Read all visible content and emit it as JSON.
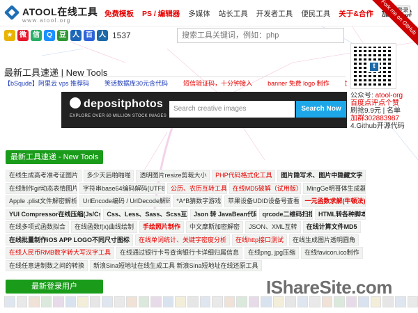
{
  "header": {
    "logo_text": "ATOOL在线工具",
    "logo_sub": "www.atool.org",
    "nav": [
      {
        "label": "免费模板",
        "style": "red bold"
      },
      {
        "label": "PS / 编辑器",
        "style": "red bold"
      },
      {
        "label": "多媒体",
        "style": ""
      },
      {
        "label": "站长工具",
        "style": ""
      },
      {
        "label": "开发者工具",
        "style": ""
      },
      {
        "label": "便民工具",
        "style": ""
      },
      {
        "label": "关于&合作",
        "style": "red bold"
      },
      {
        "label": "加 QQ 群",
        "style": "bold"
      }
    ],
    "qq_login": "QQ登录",
    "ribbon": "Fork me on GitHub"
  },
  "social": {
    "icons": [
      {
        "name": "star-icon",
        "color": "#e8b400",
        "glyph": "★"
      },
      {
        "name": "weibo-icon",
        "color": "#e6162d",
        "glyph": "微"
      },
      {
        "name": "wechat-icon",
        "color": "#2aae67",
        "glyph": "信"
      },
      {
        "name": "qq-icon",
        "color": "#1e90ff",
        "glyph": "Q"
      },
      {
        "name": "douban-icon",
        "color": "#2f9833",
        "glyph": "豆"
      },
      {
        "name": "renren-icon",
        "color": "#1d66b7",
        "glyph": "人"
      },
      {
        "name": "baidu-icon",
        "color": "#2f64d8",
        "glyph": "百"
      },
      {
        "name": "share-icon",
        "color": "#1e6aa8",
        "glyph": "人"
      }
    ],
    "count": "1537"
  },
  "search": {
    "placeholder": "搜索工具关键词，例如：php"
  },
  "qr": {
    "center_glyph": "t"
  },
  "sidebar": {
    "line1_prefix": "公众号: ",
    "line1_highlight": "atool-org",
    "line2": "百度点评点个赞",
    "line3": "刷抢9.9元 | 名单",
    "line4": "加群302883987",
    "line5": "4.Github开源代码"
  },
  "main": {
    "section_title": "最新工具速递 | New Tools",
    "tickers": [
      {
        "text": "【bSqude】阿里云 vps 推荐码",
        "style": ""
      },
      {
        "text": "笑话数据库30元含代码",
        "style": ""
      },
      {
        "text": "短信验证码，十分钟接入",
        "style": "m"
      },
      {
        "text": "banner 免费 logo 制作",
        "style": "m"
      },
      {
        "text": "加群",
        "style": "m"
      }
    ],
    "ad": {
      "brand": "depositphotos",
      "sub": "EXPLORE OVER 60 MILLION STOCK IMAGES",
      "input_placeholder": "Search creative images",
      "button": "Search Now"
    },
    "new_tools_button": "最新工具速递 - New Tools",
    "tools": [
      [
        {
          "t": "在线生成高考准考证图片",
          "s": ""
        },
        {
          "t": "多少天后啪啪啪",
          "s": ""
        },
        {
          "t": "透明图片resize剪裁大小",
          "s": ""
        },
        {
          "t": "PHP代码格式化工具",
          "s": "red"
        },
        {
          "t": "图片隐写术、图片中隐藏文字",
          "s": "b"
        }
      ],
      [
        {
          "t": "在线制作gif动态表情图片",
          "s": ""
        },
        {
          "t": "字符串base64编码解码(UTF8)",
          "s": ""
        },
        {
          "t": "公历、农历互转工具",
          "s": "red"
        },
        {
          "t": "在线MD5破解（试用版）",
          "s": "red"
        },
        {
          "t": "MingGe明哥体生成器",
          "s": ""
        }
      ],
      [
        {
          "t": "Apple .plist文件解密解析",
          "s": ""
        },
        {
          "t": "UrlEncode编码 / UrlDecode解码",
          "s": ""
        },
        {
          "t": "*A*B猜数字游戏",
          "s": ""
        },
        {
          "t": "苹果设备UDID设备号查看",
          "s": ""
        },
        {
          "t": "一元函数求解(牛顿法)",
          "s": "bred"
        }
      ],
      [
        {
          "t": "YUI Compressor在线压缩(Js/Css)",
          "s": "b"
        },
        {
          "t": "Css、Less、Sass、Scss互转",
          "s": "b"
        },
        {
          "t": "Json 转 JavaBean代码",
          "s": "b"
        },
        {
          "t": "qrcode二维码扫描",
          "s": "b"
        },
        {
          "t": "HTML转各种脚本",
          "s": "b"
        }
      ],
      [
        {
          "t": "在线多项式函数拟合",
          "s": ""
        },
        {
          "t": "在线函数f(x)曲线绘制",
          "s": ""
        },
        {
          "t": "手绘照片制作",
          "s": "bred"
        },
        {
          "t": "中文摩斯加密解密",
          "s": ""
        },
        {
          "t": "JSON、XML互转",
          "s": ""
        },
        {
          "t": "在线计算文件MD5",
          "s": "b"
        }
      ],
      [
        {
          "t": "在线批量制作iOS APP LOGO不同尺寸图标",
          "s": "b"
        },
        {
          "t": "在线单词统计、关键字密度分析",
          "s": "red"
        },
        {
          "t": "在线http接口测试",
          "s": "red"
        },
        {
          "t": "在线生成图片透明圆角",
          "s": ""
        }
      ],
      [
        {
          "t": "在线人民币RMB数字转大写汉字工具",
          "s": "red"
        },
        {
          "t": "在线通过银行卡号查询银行卡详细归属信息",
          "s": ""
        },
        {
          "t": "在线png, jpg压缩",
          "s": ""
        },
        {
          "t": "在线favicon.ico制作",
          "s": ""
        }
      ],
      [
        {
          "t": "在线任意进制数之间的转换",
          "s": ""
        },
        {
          "t": "新浪Sina短地址在线生成工具 新浪Sina短地址在线还原工具",
          "s": ""
        }
      ]
    ],
    "new_users_button": "最新登录用户",
    "watermark": "IShareSite.com"
  }
}
